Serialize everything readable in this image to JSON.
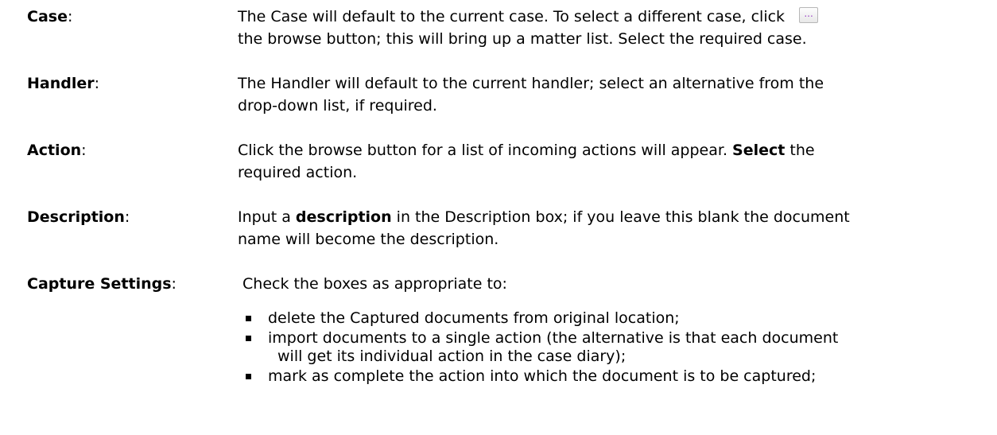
{
  "entries": [
    {
      "term": "Case",
      "colon": ":",
      "lines": [
        "The Case will default to the current case. To select a different case, click",
        "the browse button; this will bring up a matter list. Select the required case."
      ],
      "icon": "browse-button-icon",
      "icon_text": "..."
    },
    {
      "term": "Handler",
      "colon": ":",
      "lines": [
        "The Handler will default to the current handler; select an alternative from the",
        "drop-down list, if required."
      ]
    },
    {
      "term": "Action",
      "colon": ":",
      "line1": "Click the browse button for a list of incoming actions will appear. ",
      "line1_bold": "Select",
      "line1_end": " the",
      "line2": "required action."
    },
    {
      "term": "Description",
      "colon": ":",
      "line1": "Input a ",
      "line1_bold": "description",
      "line1_end": " in the Description box; if you leave this blank the document",
      "line2": "name will become the description."
    },
    {
      "term": "Capture Settings",
      "colon": ":",
      "intro": " Check the boxes as appropriate to:",
      "bullets": [
        {
          "first": "delete the Captured documents from original location;"
        },
        {
          "first": "import documents to a single action (the alternative is that each document",
          "cont": "will get its individual action in the case diary);"
        },
        {
          "first": "mark as complete the action into which the document is to be captured;"
        }
      ]
    }
  ],
  "colors": {
    "text": "#000000",
    "button_dots": "#9b3fc4",
    "button_border": "#b7b7b7"
  }
}
